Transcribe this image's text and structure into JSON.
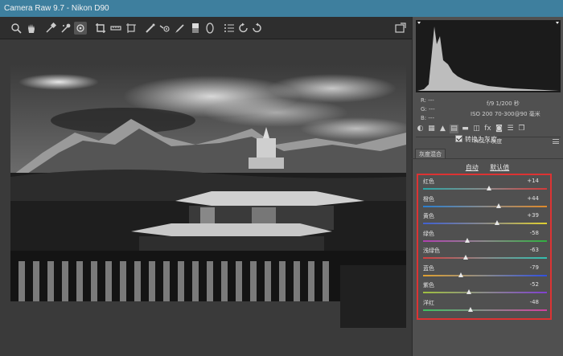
{
  "window": {
    "title": "Camera Raw 9.7 -  Nikon D90"
  },
  "toolbar": {
    "tools": [
      {
        "icon": "zoom-icon"
      },
      {
        "icon": "hand-icon"
      },
      {
        "icon": "white-balance-icon"
      },
      {
        "icon": "color-sampler-icon"
      },
      {
        "icon": "targeted-adjustment-icon"
      },
      {
        "icon": "crop-icon"
      },
      {
        "icon": "straighten-icon"
      },
      {
        "icon": "transform-icon"
      },
      {
        "icon": "spot-removal-icon"
      },
      {
        "icon": "red-eye-icon"
      },
      {
        "icon": "adjustment-brush-icon"
      },
      {
        "icon": "graduated-filter-icon"
      },
      {
        "icon": "radial-filter-icon"
      },
      {
        "icon": "list-icon"
      },
      {
        "icon": "rotate-left-icon"
      },
      {
        "icon": "rotate-right-icon"
      }
    ]
  },
  "info": {
    "r_label": "R:",
    "g_label": "G:",
    "b_label": "B:",
    "r_value": "---",
    "g_value": "---",
    "b_value": "---",
    "exposure": "f/9   1/200 秒",
    "iso_lens": "ISO 200   70-300@90 毫米"
  },
  "panel": {
    "title": "HSL / 灰度",
    "convert_label": "转换为灰度",
    "convert_checked": true,
    "subtab": "灰度混合",
    "auto_link": "自动",
    "default_link": "默认值"
  },
  "sliders": [
    {
      "name": "红色",
      "value": "+14",
      "level": 14,
      "color_left": "#2aa6a6",
      "color_right": "#d23a3a"
    },
    {
      "name": "橙色",
      "value": "+44",
      "level": 44,
      "color_left": "#2a7fd0",
      "color_right": "#e08a2a"
    },
    {
      "name": "黄色",
      "value": "+39",
      "level": 39,
      "color_left": "#4060d0",
      "color_right": "#e0d030"
    },
    {
      "name": "绿色",
      "value": "-58",
      "level": -58,
      "color_left": "#b040b0",
      "color_right": "#30b040"
    },
    {
      "name": "浅绿色",
      "value": "-63",
      "level": -63,
      "color_left": "#d04040",
      "color_right": "#30c0b0"
    },
    {
      "name": "蓝色",
      "value": "-79",
      "level": -79,
      "color_left": "#e0a030",
      "color_right": "#3050e0"
    },
    {
      "name": "紫色",
      "value": "-52",
      "level": -52,
      "color_left": "#a0c040",
      "color_right": "#8040d0"
    },
    {
      "name": "洋红",
      "value": "-48",
      "level": -48,
      "color_left": "#40c060",
      "color_right": "#d040a0"
    }
  ],
  "colors": {
    "titlebar": "#3e7f9e",
    "highlight_box": "#d33333"
  }
}
